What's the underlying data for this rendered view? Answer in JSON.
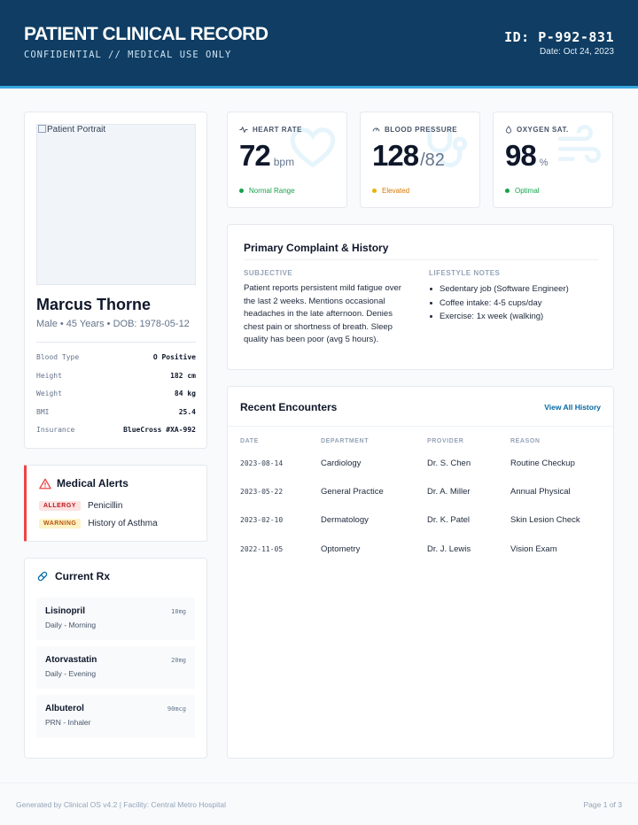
{
  "header": {
    "title": "PATIENT CLINICAL RECORD",
    "subtitle": "CONFIDENTIAL // MEDICAL USE ONLY",
    "patient_id": "ID: P-992-831",
    "date": "Date: Oct 24, 2023"
  },
  "patient": {
    "portrait_alt": "Patient Portrait",
    "name": "Marcus Thorne",
    "demographics": "Male • 45 Years • DOB: 1978-05-12",
    "details": [
      {
        "label": "Blood Type",
        "value": "O Positive"
      },
      {
        "label": "Height",
        "value": "182 cm"
      },
      {
        "label": "Weight",
        "value": "84 kg"
      },
      {
        "label": "BMI",
        "value": "25.4"
      },
      {
        "label": "Insurance",
        "value": "BlueCross #XA-992"
      }
    ]
  },
  "alerts": {
    "title": "Medical Alerts",
    "icon": "warning-triangle-icon",
    "color": "#ef4444",
    "items": [
      {
        "tag": "ALLERGY",
        "text": "Penicillin"
      },
      {
        "tag": "WARNING",
        "text": "History of Asthma"
      }
    ]
  },
  "rx": {
    "title": "Current Rx",
    "icon": "pill-icon",
    "items": [
      {
        "name": "Lisinopril",
        "frequency": "Daily - Morning",
        "dose": "10mg"
      },
      {
        "name": "Atorvastatin",
        "frequency": "Daily - Evening",
        "dose": "20mg"
      },
      {
        "name": "Albuterol",
        "frequency": "PRN - Inhaler",
        "dose": "90mcg"
      }
    ]
  },
  "stats": {
    "heart": {
      "label": "HEART RATE",
      "value": "72",
      "unit": "bpm",
      "status": "Normal Range",
      "status_color": "#16a34a",
      "icon": "heart-pulse-icon"
    },
    "bp": {
      "label": "BLOOD PRESSURE",
      "value": "128",
      "slash": "/",
      "secondary": "82",
      "status": "Elevated",
      "status_color": "#d97706",
      "icon": "gauge-icon"
    },
    "oxygen": {
      "label": "OXYGEN SAT.",
      "value": "98",
      "unit": "%",
      "status": "Optimal",
      "status_color": "#16a34a",
      "icon": "droplet-icon"
    }
  },
  "complaint": {
    "title": "Primary Complaint & History",
    "subjective_heading": "SUBJECTIVE",
    "subjective_text": "Patient reports persistent mild fatigue over the last 2 weeks. Mentions occasional headaches in the late afternoon. Denies chest pain or shortness of breath. Sleep quality has been poor (avg 5 hours).",
    "lifestyle_heading": "LIFESTYLE NOTES",
    "lifestyle": [
      "Sedentary job (Software Engineer)",
      "Coffee intake: 4-5 cups/day",
      "Exercise: 1x week (walking)"
    ]
  },
  "encounters": {
    "title": "Recent Encounters",
    "link": "View All History",
    "columns": [
      "DATE",
      "DEPARTMENT",
      "PROVIDER",
      "REASON"
    ],
    "rows": [
      {
        "date": "2023-08-14",
        "department": "Cardiology",
        "provider": "Dr. S. Chen",
        "reason": "Routine Checkup"
      },
      {
        "date": "2023-05-22",
        "department": "General Practice",
        "provider": "Dr. A. Miller",
        "reason": "Annual Physical"
      },
      {
        "date": "2023-02-10",
        "department": "Dermatology",
        "provider": "Dr. K. Patel",
        "reason": "Skin Lesion Check"
      },
      {
        "date": "2022-11-05",
        "department": "Optometry",
        "provider": "Dr. J. Lewis",
        "reason": "Vision Exam"
      }
    ]
  },
  "footer": {
    "left": "Generated by Clinical OS v4.2 | Facility: Central Metro Hospital",
    "right": "Page 1 of 3"
  }
}
